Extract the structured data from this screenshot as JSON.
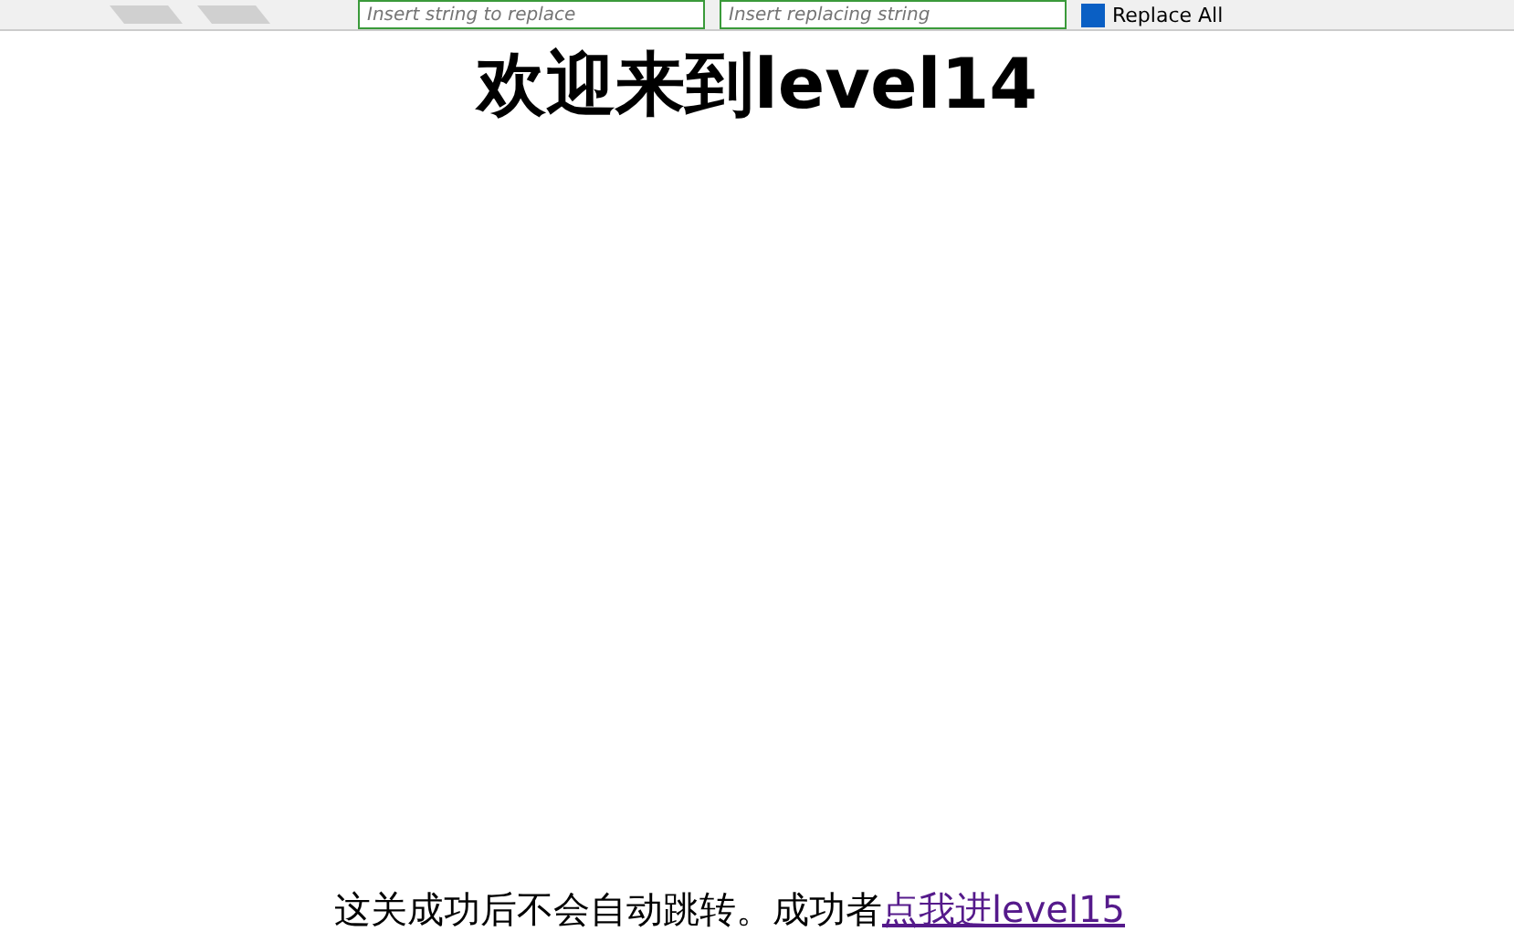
{
  "toolbar": {
    "find_field": {
      "placeholder": "Insert string to replace"
    },
    "replace_field": {
      "placeholder": "Insert replacing string"
    },
    "replace_all": {
      "label": "Replace All",
      "checked": true
    }
  },
  "heading": "欢迎来到level14",
  "footer": {
    "text": "这关成功后不会自动跳转。成功者",
    "link": "点我进level15"
  }
}
